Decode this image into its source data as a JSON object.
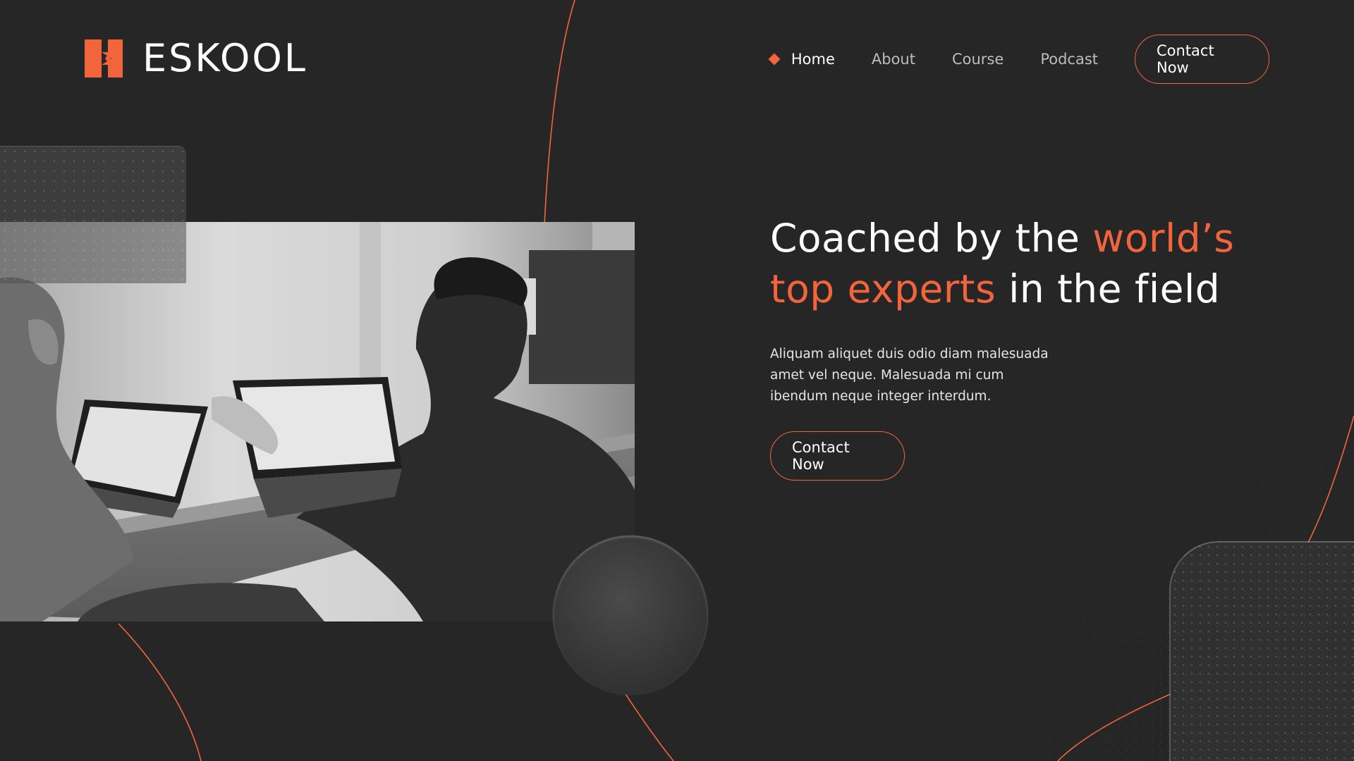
{
  "brand": {
    "name": "ESKOOL",
    "accent_color": "#f2643c",
    "background_color": "#262626",
    "logo_icon": "eskool-logo-icon"
  },
  "nav": {
    "items": [
      {
        "label": "Home",
        "active": true,
        "icon": "diamond-icon"
      },
      {
        "label": "About",
        "active": false
      },
      {
        "label": "Course",
        "active": false
      },
      {
        "label": "Podcast",
        "active": false
      }
    ],
    "cta_label": "Contact Now"
  },
  "hero": {
    "headline_part1": "Coached by the ",
    "headline_accent1": "world’s",
    "headline_accent2": "top experts",
    "headline_part2": " in the field",
    "description": "Aliquam aliquet duis odio diam malesuada amet vel neque. Malesuada mi cum ibendum neque integer interdum.",
    "cta_label": "Contact Now"
  },
  "image": {
    "subject": "photo-two-people-working-on-laptops"
  }
}
